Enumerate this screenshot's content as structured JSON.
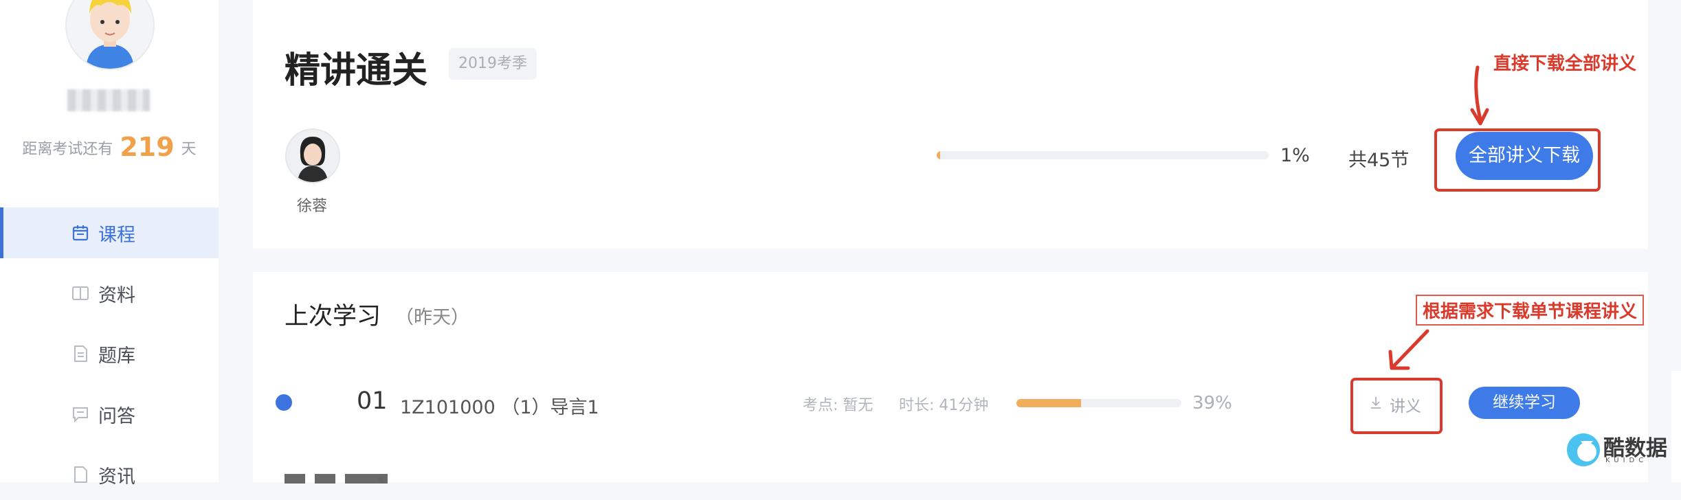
{
  "sidebar": {
    "username": "",
    "countdown": {
      "prefix": "距离考试还有",
      "days": "219",
      "suffix": "天"
    },
    "items": [
      {
        "label": "课程",
        "icon": "calendar-icon",
        "active": true
      },
      {
        "label": "资料",
        "icon": "book-icon",
        "active": false
      },
      {
        "label": "题库",
        "icon": "document-icon",
        "active": false
      },
      {
        "label": "问答",
        "icon": "chat-icon",
        "active": false
      },
      {
        "label": "资讯",
        "icon": "news-icon",
        "active": false
      }
    ]
  },
  "course": {
    "title": "精讲通关",
    "season": "2019考季",
    "teacher": "徐蓉",
    "progress_percent": 1,
    "progress_label": "1%",
    "lesson_count": "共45节",
    "download_all_label": "全部讲义下载"
  },
  "annotations": {
    "download_all": "直接下载全部讲义",
    "download_single": "根据需求下载单节课程讲义",
    "color": "#d93a2b"
  },
  "last_study": {
    "title": "上次学习",
    "when": "（昨天）",
    "lesson": {
      "number": "01",
      "name": "1Z101000 （1）导言1",
      "exam_point": "考点: 暂无",
      "duration": "时长: 41分钟",
      "progress_percent": 39,
      "progress_label": "39%",
      "handout_label": "讲义",
      "continue_label": "继续学习"
    }
  },
  "watermark": {
    "text": "酷数据",
    "sub": "KUIDC"
  },
  "colors": {
    "primary": "#3e7be8",
    "accent_orange": "#f0a14a",
    "progress_orange": "#f2ad5b"
  }
}
